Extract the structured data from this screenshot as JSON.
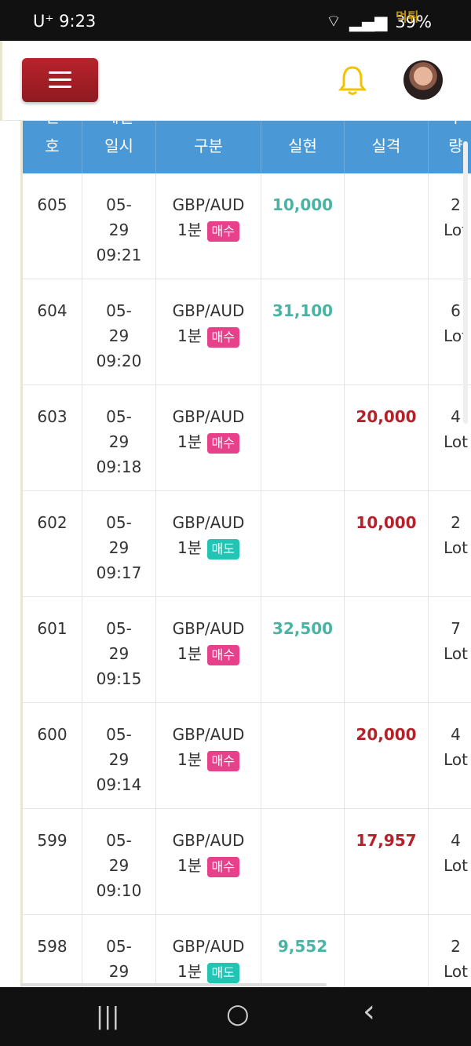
{
  "status": {
    "carrier": "U⁺ 9:23",
    "battery": "39%",
    "watermark": "먹튀"
  },
  "header": {
    "menu_icon": "hamburger-icon",
    "bell_icon": "bell-icon",
    "avatar": "user-avatar"
  },
  "table": {
    "columns": [
      {
        "line1": "번",
        "line2": "호"
      },
      {
        "line1": "체결",
        "line2": "일시"
      },
      {
        "line1": "",
        "line2": "구분"
      },
      {
        "line1": "",
        "line2": "실현"
      },
      {
        "line1": "",
        "line2": "실격"
      },
      {
        "line1": "수",
        "line2": "량"
      }
    ],
    "rows": [
      {
        "no": "605",
        "date": "05-",
        "day": "29",
        "time": "09:21",
        "pair": "GBP/AUD",
        "period": "1분",
        "side": "매수",
        "side_type": "buy",
        "gain": "10,000",
        "loss": "",
        "qty": "2",
        "unit": "Lot"
      },
      {
        "no": "604",
        "date": "05-",
        "day": "29",
        "time": "09:20",
        "pair": "GBP/AUD",
        "period": "1분",
        "side": "매수",
        "side_type": "buy",
        "gain": "31,100",
        "loss": "",
        "qty": "6",
        "unit": "Lot"
      },
      {
        "no": "603",
        "date": "05-",
        "day": "29",
        "time": "09:18",
        "pair": "GBP/AUD",
        "period": "1분",
        "side": "매수",
        "side_type": "buy",
        "gain": "",
        "loss": "20,000",
        "qty": "4",
        "unit": "Lot"
      },
      {
        "no": "602",
        "date": "05-",
        "day": "29",
        "time": "09:17",
        "pair": "GBP/AUD",
        "period": "1분",
        "side": "매도",
        "side_type": "sell",
        "gain": "",
        "loss": "10,000",
        "qty": "2",
        "unit": "Lot"
      },
      {
        "no": "601",
        "date": "05-",
        "day": "29",
        "time": "09:15",
        "pair": "GBP/AUD",
        "period": "1분",
        "side": "매수",
        "side_type": "buy",
        "gain": "32,500",
        "loss": "",
        "qty": "7",
        "unit": "Lot"
      },
      {
        "no": "600",
        "date": "05-",
        "day": "29",
        "time": "09:14",
        "pair": "GBP/AUD",
        "period": "1분",
        "side": "매수",
        "side_type": "buy",
        "gain": "",
        "loss": "20,000",
        "qty": "4",
        "unit": "Lot"
      },
      {
        "no": "599",
        "date": "05-",
        "day": "29",
        "time": "09:10",
        "pair": "GBP/AUD",
        "period": "1분",
        "side": "매수",
        "side_type": "buy",
        "gain": "",
        "loss": "17,957",
        "qty": "4",
        "unit": "Lot"
      },
      {
        "no": "598",
        "date": "05-",
        "day": "29",
        "time": "",
        "pair": "GBP/AUD",
        "period": "1분",
        "side": "매도",
        "side_type": "sell",
        "gain": "9,552",
        "loss": "",
        "qty": "2",
        "unit": "Lot"
      }
    ]
  },
  "navbar": {
    "recent": "|||",
    "home": "○",
    "back": "‹"
  },
  "colors": {
    "header_blue": "#4a98d6",
    "buy": "#e8418c",
    "sell": "#22c4b4",
    "gain": "#4ab4a4",
    "loss": "#b5212a",
    "menu_red": "#a51f26"
  }
}
